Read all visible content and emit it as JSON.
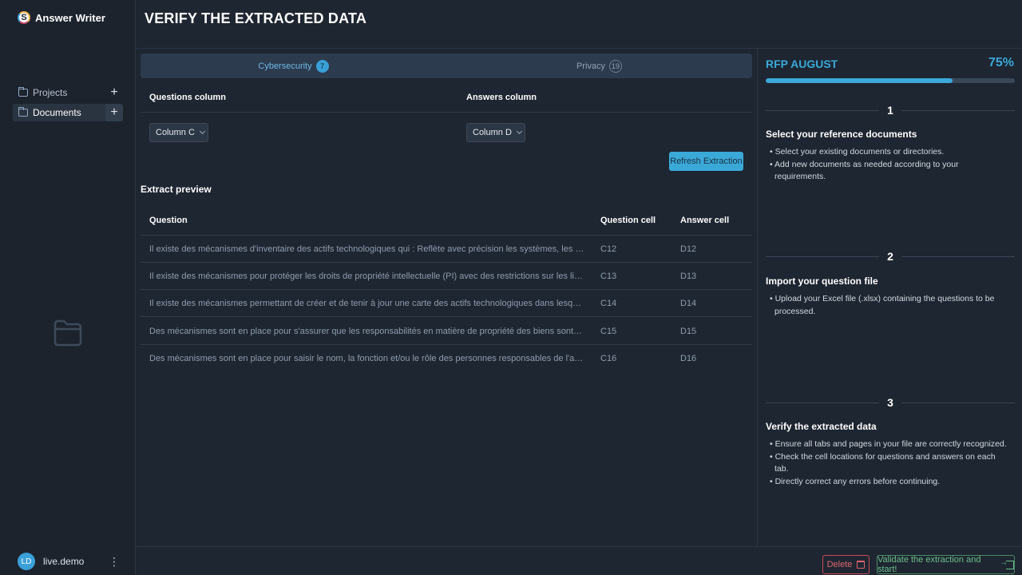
{
  "app": {
    "name": "Answer Writer",
    "logo_letter": "S"
  },
  "sidebar": {
    "items": [
      {
        "label": "Projects"
      },
      {
        "label": "Documents"
      }
    ],
    "user": {
      "initials": "LD",
      "name": "live.demo"
    }
  },
  "header": {
    "title": "VERIFY THE EXTRACTED DATA"
  },
  "tabs": [
    {
      "label": "Cybersecurity",
      "count": "7"
    },
    {
      "label": "Privacy",
      "count": "19"
    }
  ],
  "columns": {
    "questions_label": "Questions column",
    "answers_label": "Answers column",
    "questions_value": "Column C",
    "answers_value": "Column D",
    "refresh_label": "Refresh Extraction"
  },
  "preview": {
    "title": "Extract preview",
    "headers": [
      "Question",
      "Question cell",
      "Answer cell"
    ],
    "rows": [
      {
        "question": "Il existe des mécanismes d'inventaire des actifs technologiques qui : Reflète avec précision les systèmes, les applications et les données",
        "qcell": "C12",
        "acell": "D12"
      },
      {
        "question": "Il existe des mécanismes pour protéger les droits de propriété intellectuelle (PI) avec des restrictions sur les licences de logiciels",
        "qcell": "C13",
        "acell": "D13"
      },
      {
        "question": "Il existe des mécanismes permettant de créer et de tenir à jour une carte des actifs technologiques dans lesquels des données sensibles",
        "qcell": "C14",
        "acell": "D14"
      },
      {
        "question": "Des mécanismes sont en place pour s'assurer que les responsabilités en matière de propriété des biens sont attribuées, suivies",
        "qcell": "C15",
        "acell": "D15"
      },
      {
        "question": "Des mécanismes sont en place pour saisir le nom, la fonction et/ou le rôle des personnes responsables de l'administration des actifs",
        "qcell": "C16",
        "acell": "D16"
      }
    ]
  },
  "rfp": {
    "title": "RFP AUGUST",
    "percent_label": "75%",
    "progress": 0.75,
    "steps": [
      {
        "number": "1",
        "title": "Select your reference documents",
        "bullets": [
          "Select your existing documents or directories.",
          "Add new documents as needed according to your requirements."
        ]
      },
      {
        "number": "2",
        "title": "Import your question file",
        "bullets": [
          "Upload your Excel file (.xlsx) containing the questions to be processed."
        ]
      },
      {
        "number": "3",
        "title": "Verify the extracted data",
        "bullets": [
          "Ensure all tabs and pages in your file are correctly recognized.",
          "Check the cell locations for questions and answers on each tab.",
          "Directly correct any errors before continuing."
        ]
      }
    ]
  },
  "footer": {
    "delete_label": "Delete",
    "validate_label": "Validate the extraction and start!"
  },
  "colors": {
    "accent": "#3aa9d8",
    "danger": "#e06570",
    "success": "#6cc08a",
    "background": "#1e2631"
  }
}
